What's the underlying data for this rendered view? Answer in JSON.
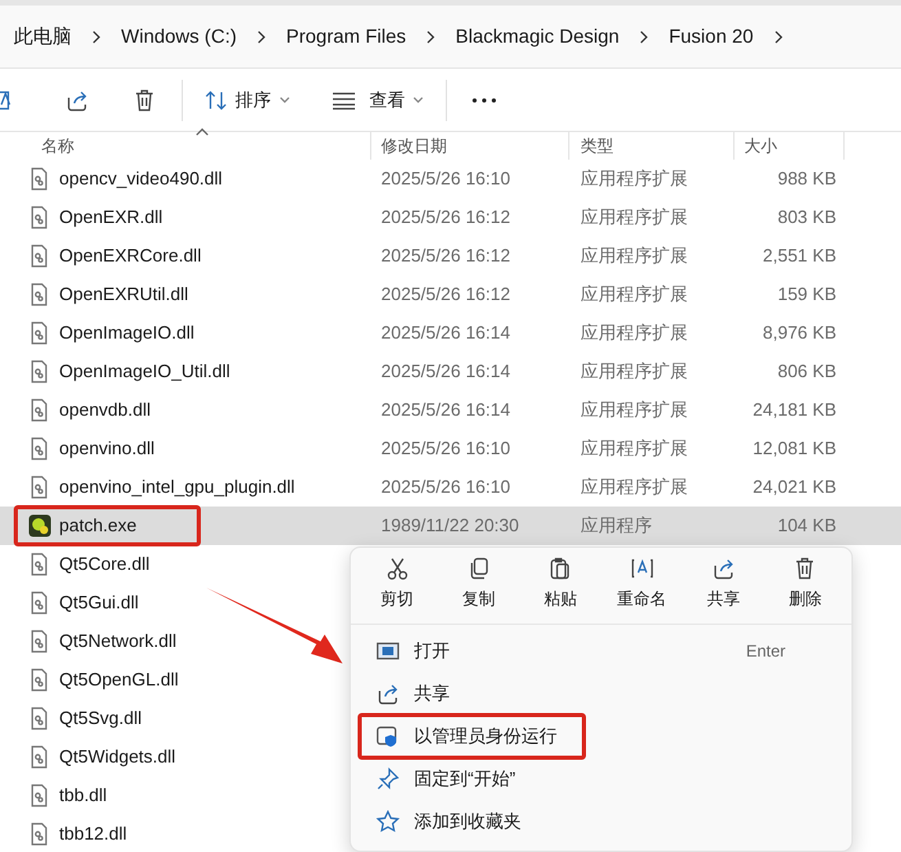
{
  "breadcrumb": [
    "此电脑",
    "Windows (C:)",
    "Program Files",
    "Blackmagic Design",
    "Fusion 20"
  ],
  "toolbar": {
    "sort": "排序",
    "view": "查看"
  },
  "columns": [
    "名称",
    "修改日期",
    "类型",
    "大小"
  ],
  "files": [
    {
      "name": "opencv_video490.dll",
      "kind": "dll",
      "date": "2025/5/26 16:10",
      "type": "应用程序扩展",
      "size": "988 KB",
      "selected": false,
      "highlighted": false
    },
    {
      "name": "OpenEXR.dll",
      "kind": "dll",
      "date": "2025/5/26 16:12",
      "type": "应用程序扩展",
      "size": "803 KB",
      "selected": false,
      "highlighted": false
    },
    {
      "name": "OpenEXRCore.dll",
      "kind": "dll",
      "date": "2025/5/26 16:12",
      "type": "应用程序扩展",
      "size": "2,551 KB",
      "selected": false,
      "highlighted": false
    },
    {
      "name": "OpenEXRUtil.dll",
      "kind": "dll",
      "date": "2025/5/26 16:12",
      "type": "应用程序扩展",
      "size": "159 KB",
      "selected": false,
      "highlighted": false
    },
    {
      "name": "OpenImageIO.dll",
      "kind": "dll",
      "date": "2025/5/26 16:14",
      "type": "应用程序扩展",
      "size": "8,976 KB",
      "selected": false,
      "highlighted": false
    },
    {
      "name": "OpenImageIO_Util.dll",
      "kind": "dll",
      "date": "2025/5/26 16:14",
      "type": "应用程序扩展",
      "size": "806 KB",
      "selected": false,
      "highlighted": false
    },
    {
      "name": "openvdb.dll",
      "kind": "dll",
      "date": "2025/5/26 16:14",
      "type": "应用程序扩展",
      "size": "24,181 KB",
      "selected": false,
      "highlighted": false
    },
    {
      "name": "openvino.dll",
      "kind": "dll",
      "date": "2025/5/26 16:10",
      "type": "应用程序扩展",
      "size": "12,081 KB",
      "selected": false,
      "highlighted": false
    },
    {
      "name": "openvino_intel_gpu_plugin.dll",
      "kind": "dll",
      "date": "2025/5/26 16:10",
      "type": "应用程序扩展",
      "size": "24,021 KB",
      "selected": false,
      "highlighted": false
    },
    {
      "name": "patch.exe",
      "kind": "exe",
      "date": "1989/11/22 20:30",
      "type": "应用程序",
      "size": "104 KB",
      "selected": true,
      "highlighted": true
    },
    {
      "name": "Qt5Core.dll",
      "kind": "dll",
      "selected": false,
      "highlighted": false
    },
    {
      "name": "Qt5Gui.dll",
      "kind": "dll",
      "selected": false,
      "highlighted": false
    },
    {
      "name": "Qt5Network.dll",
      "kind": "dll",
      "selected": false,
      "highlighted": false
    },
    {
      "name": "Qt5OpenGL.dll",
      "kind": "dll",
      "selected": false,
      "highlighted": false
    },
    {
      "name": "Qt5Svg.dll",
      "kind": "dll",
      "selected": false,
      "highlighted": false
    },
    {
      "name": "Qt5Widgets.dll",
      "kind": "dll",
      "selected": false,
      "highlighted": false
    },
    {
      "name": "tbb.dll",
      "kind": "dll",
      "selected": false,
      "highlighted": false
    },
    {
      "name": "tbb12.dll",
      "kind": "dll",
      "selected": false,
      "highlighted": false
    }
  ],
  "context_menu": {
    "actions": [
      {
        "kind": "cut",
        "label": "剪切"
      },
      {
        "kind": "copy",
        "label": "复制"
      },
      {
        "kind": "paste",
        "label": "粘贴"
      },
      {
        "kind": "rename",
        "label": "重命名"
      },
      {
        "kind": "share",
        "label": "共享"
      },
      {
        "kind": "delete",
        "label": "删除"
      }
    ],
    "items": [
      {
        "kind": "open",
        "label": "打开",
        "shortcut": "Enter",
        "highlighted": false
      },
      {
        "kind": "share",
        "label": "共享",
        "highlighted": false
      },
      {
        "kind": "admin",
        "label": "以管理员身份运行",
        "highlighted": true
      },
      {
        "kind": "pin",
        "label": "固定到“开始”",
        "highlighted": false
      },
      {
        "kind": "star",
        "label": "添加到收藏夹",
        "highlighted": false
      }
    ]
  }
}
